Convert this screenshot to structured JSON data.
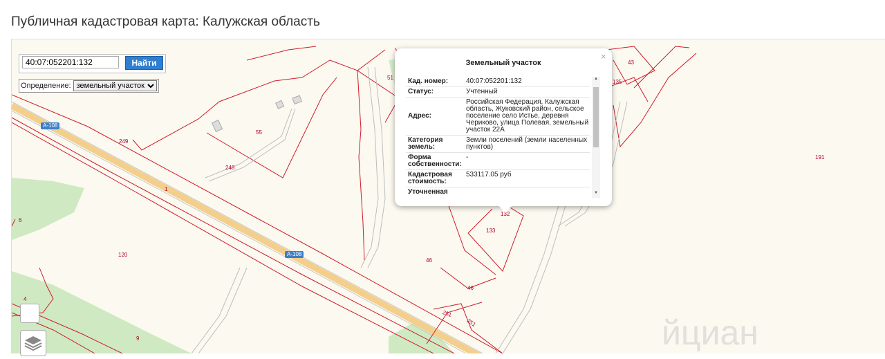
{
  "page": {
    "title": "Публичная кадастровая карта: Калужская область"
  },
  "search": {
    "value": "40:07:052201:132",
    "button": "Найти"
  },
  "definition": {
    "label": "Определение:",
    "selected": "земельный участок"
  },
  "popup": {
    "title": "Земельный участок",
    "close": "×",
    "rows": [
      {
        "k": "Кад. номер:",
        "v": "40:07:052201:132"
      },
      {
        "k": "Статус:",
        "v": "Учтенный"
      },
      {
        "k": "Адрес:",
        "v": "Российская Федерация, Калужская область, Жуковский район, сельское поселение село Истье, деревня Чериково, улица Полевая, земельный участок 22А"
      },
      {
        "k": "Категория земель:",
        "v": "Земли поселений (земли населенных пунктов)"
      },
      {
        "k": "Форма собственности:",
        "v": "-"
      },
      {
        "k": "Кадастровая стоимость:",
        "v": "533117.05 руб"
      },
      {
        "k": "Уточненная",
        "v": ""
      }
    ]
  },
  "map": {
    "parcel_labels": [
      "51",
      "55",
      "249",
      "248",
      "1",
      "6",
      "120",
      "4",
      "9",
      "46",
      "46",
      "251",
      "251",
      "132",
      "133",
      "43",
      "135",
      "191"
    ],
    "road_badges": [
      "A-108",
      "A-108"
    ],
    "watermark": "йциан"
  },
  "colors": {
    "parcel_line": "#d01b2a",
    "road": "#f3cf8b",
    "green": "#cfe9c2",
    "button": "#2f7fd1"
  },
  "icons": [
    "layers-icon",
    "close-icon",
    "chevron-down-icon"
  ]
}
